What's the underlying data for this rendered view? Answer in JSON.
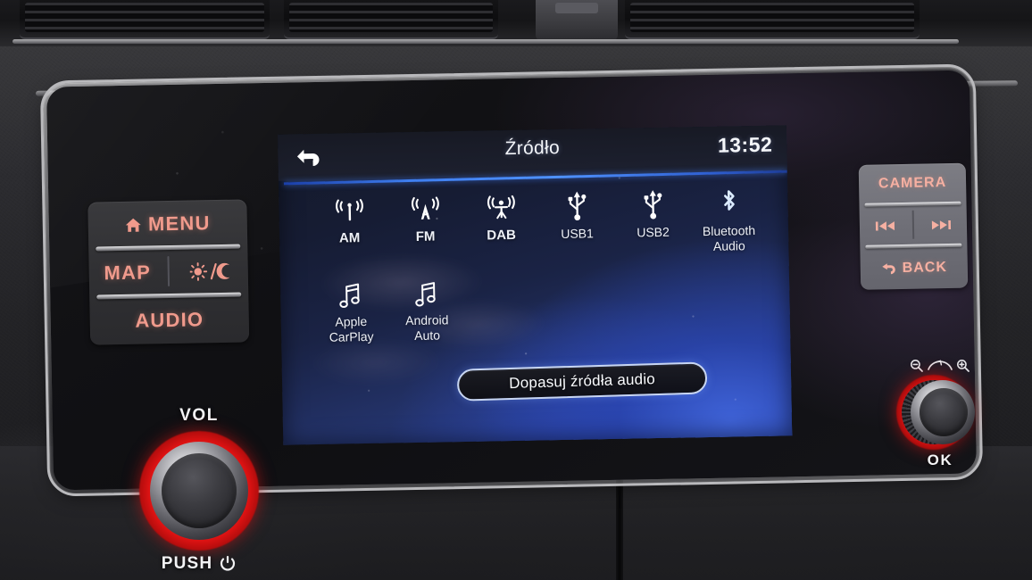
{
  "screen": {
    "header": {
      "back_icon": "back-arrow-icon",
      "title": "Źródło",
      "time": "13:52"
    },
    "sources_row1": [
      {
        "label": "AM",
        "icon": "am-radio-antenna-icon"
      },
      {
        "label": "FM",
        "icon": "fm-radio-antenna-icon"
      },
      {
        "label": "DAB",
        "icon": "dab-radio-antenna-icon"
      },
      {
        "label": "USB1",
        "icon": "usb-icon"
      },
      {
        "label": "USB2",
        "icon": "usb-icon"
      },
      {
        "label": "Bluetooth\nAudio",
        "icon": "bluetooth-icon"
      }
    ],
    "sources_row2": [
      {
        "label": "Apple\nCarPlay",
        "icon": "music-note-icon"
      },
      {
        "label": "Android\nAuto",
        "icon": "music-note-icon"
      }
    ],
    "customize_button": "Dopasuj źródła audio"
  },
  "left_buttons": {
    "menu": "MENU",
    "map": "MAP",
    "audio": "AUDIO",
    "menu_icon": "home-icon",
    "daynight_icon": "sun-moon-icon"
  },
  "right_buttons": {
    "camera": "CAMERA",
    "back": "BACK",
    "prev_icon": "previous-track-icon",
    "next_icon": "next-track-icon",
    "back_icon": "back-arrow-icon"
  },
  "volume_knob": {
    "label": "VOL",
    "push_label": "PUSH",
    "power_icon": "power-icon"
  },
  "ok_knob": {
    "label": "OK",
    "zoom_out_icon": "zoom-out-icon",
    "zoom_in_icon": "zoom-in-icon"
  },
  "colors": {
    "button_backlight": "#f09a8c",
    "knob_ring": "#e81414",
    "screen_accent": "#4f92ff",
    "screen_bg": "#2b44a0"
  }
}
